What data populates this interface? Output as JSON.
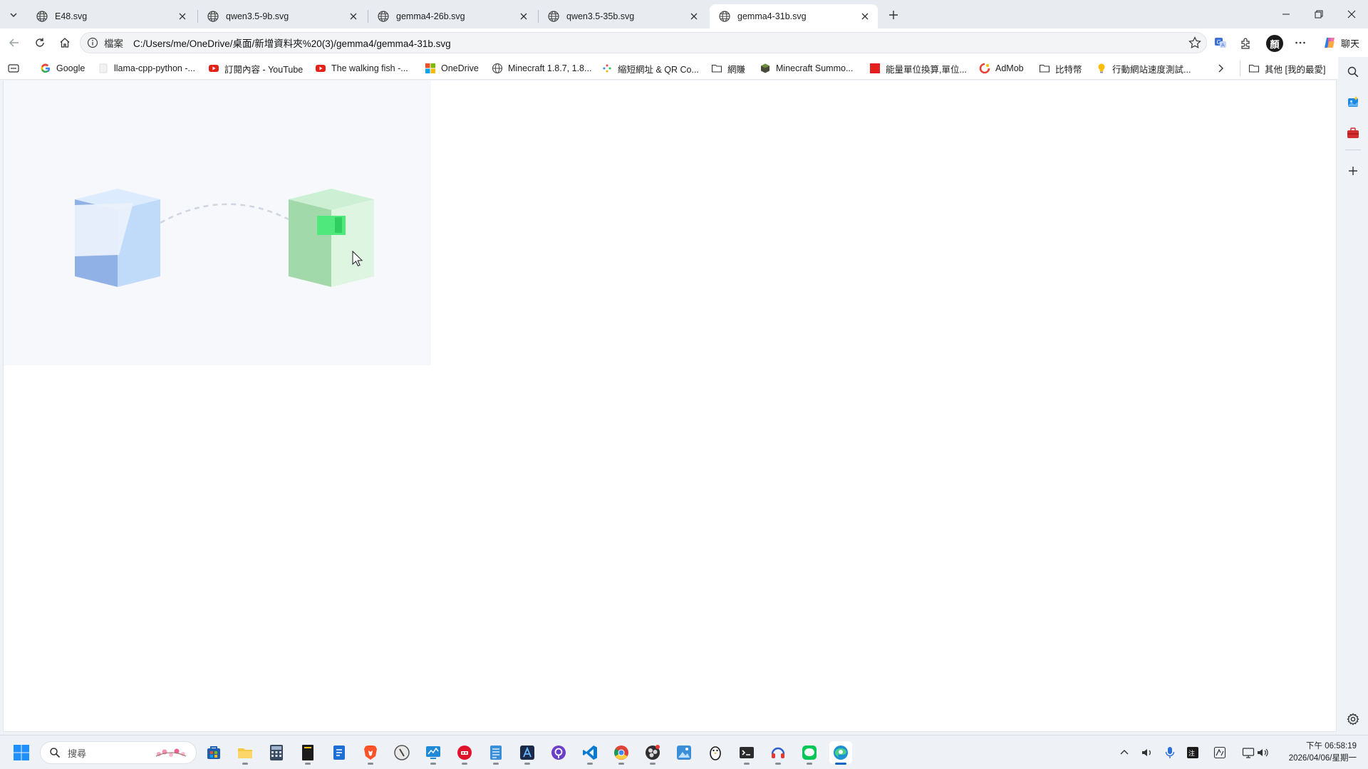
{
  "tabs": [
    {
      "title": "E48.svg",
      "active": false
    },
    {
      "title": "qwen3.5-9b.svg",
      "active": false
    },
    {
      "title": "gemma4-26b.svg",
      "active": false
    },
    {
      "title": "qwen3.5-35b.svg",
      "active": false
    },
    {
      "title": "gemma4-31b.svg",
      "active": true
    }
  ],
  "address": {
    "scheme_label": "檔案",
    "url": "C:/Users/me/OneDrive/桌面/新增資料夾%20(3)/gemma4/gemma4-31b.svg"
  },
  "toolbar": {
    "profile_initial": "顏",
    "copilot_label": "聊天"
  },
  "favorites": [
    {
      "label": "Google",
      "icon": "google-icon"
    },
    {
      "label": "llama-cpp-python -...",
      "icon": "page-icon"
    },
    {
      "label": "訂閱內容 - YouTube",
      "icon": "youtube-icon"
    },
    {
      "label": "The walking fish -...",
      "icon": "youtube-icon"
    },
    {
      "label": "OneDrive",
      "icon": "microsoft-icon"
    },
    {
      "label": "Minecraft 1.8.7, 1.8...",
      "icon": "globe-icon"
    },
    {
      "label": "縮短網址 & QR Co...",
      "icon": "dots-icon"
    },
    {
      "label": "網賺",
      "icon": "folder-icon"
    },
    {
      "label": "Minecraft Summo...",
      "icon": "minecraft-icon"
    },
    {
      "label": "能量單位換算,單位...",
      "icon": "red-square-icon"
    },
    {
      "label": "AdMob",
      "icon": "admob-icon"
    },
    {
      "label": "比特幣",
      "icon": "folder-icon"
    },
    {
      "label": "行動網站速度測試...",
      "icon": "bulb-icon"
    }
  ],
  "favorites_other": "其他 [我的最愛]",
  "taskbar": {
    "search_placeholder": "搜尋",
    "clock_time": "下午 06:58:19",
    "clock_date": "2026/04/06/星期一"
  },
  "colors": {
    "cube_blue_top": "#dcebfd",
    "cube_blue_left": "#8fb1e5",
    "cube_blue_right": "#c0dbfa",
    "cube_green_top": "#cdefd3",
    "cube_green_left": "#a2d9aa",
    "cube_green_right": "#ddf5e1",
    "signal_green": "#4ee87d",
    "accent": "#0a66c2"
  }
}
